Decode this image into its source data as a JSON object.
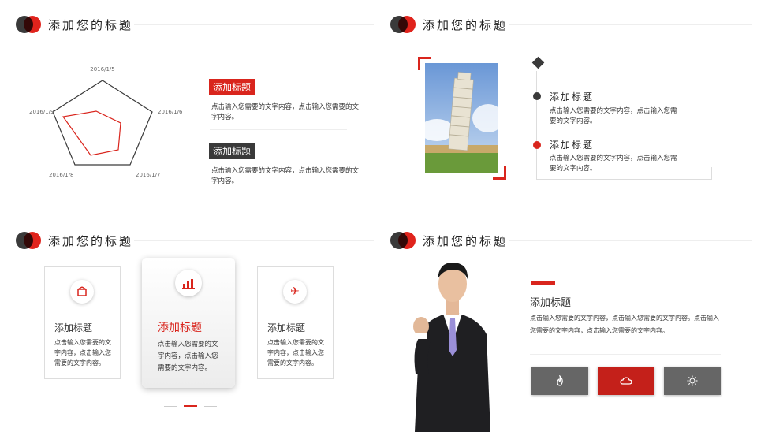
{
  "q1": {
    "title": "添加您的标题",
    "radar_labels": [
      "2016/1/5",
      "2016/1/6",
      "2016/1/7",
      "2016/1/8",
      "2016/1/9"
    ],
    "item1_title": "添加标题",
    "item1_text": "点击输入您需要的文字内容，点击输入您需要的文字内容。",
    "item2_title": "添加标题",
    "item2_text": "点击输入您需要的文字内容，点击输入您需要的文字内容。"
  },
  "q2": {
    "title": "添加您的标题",
    "item1_title": "添加标题",
    "item1_text": "点击输入您需要的文字内容，点击输入您需要的文字内容。",
    "item2_title": "添加标题",
    "item2_text": "点击输入您需要的文字内容，点击输入您需要的文字内容。"
  },
  "q3": {
    "title": "添加您的标题",
    "cards": [
      {
        "title": "添加标题",
        "text": "点击输入您需要的文字内容，点击输入您需要的文字内容。",
        "icon": "box-icon"
      },
      {
        "title": "添加标题",
        "text": "点击输入您需要的文字内容，点击输入您需要的文字内容。",
        "icon": "bar-chart-icon"
      },
      {
        "title": "添加标题",
        "text": "点击输入您需要的文字内容，点击输入您需要的文字内容。",
        "icon": "airplane-icon"
      }
    ]
  },
  "q4": {
    "title": "添加您的标题",
    "heading": "添加标题",
    "text": "点击输入您需要的文字内容，点击输入您需要的文字内容。点击输入您需要的文字内容，点击输入您需要的文字内容。",
    "buttons": [
      "fire-icon",
      "cloud-icon",
      "sun-icon"
    ]
  },
  "colors": {
    "red": "#d9251d",
    "dark": "#3a3a3a",
    "grey": "#666666"
  }
}
